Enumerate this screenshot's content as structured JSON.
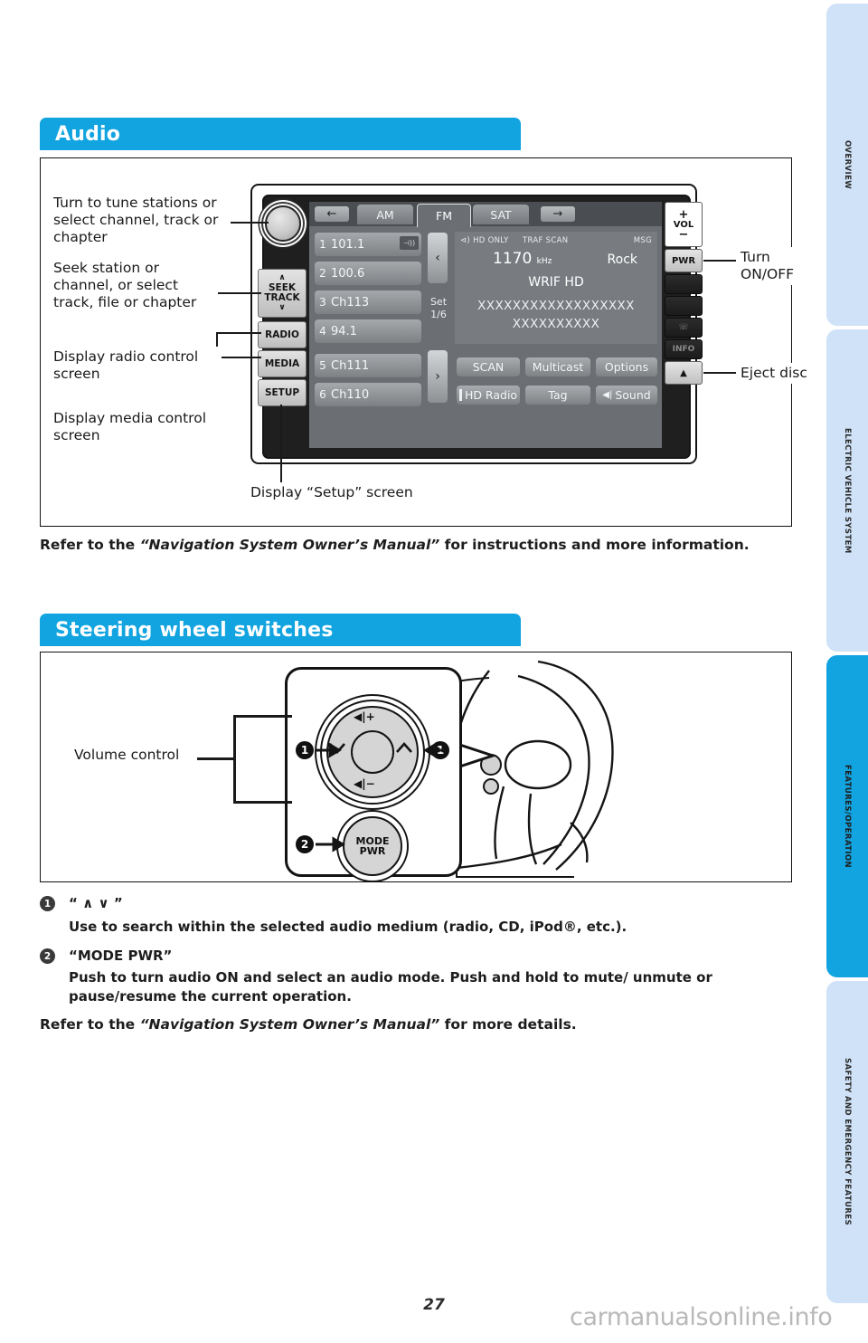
{
  "page": {
    "number": "27",
    "watermark": "carmanualsonline.info",
    "accent_color": "#12a4e0",
    "tab_inactive_color": "#cfe2f7"
  },
  "side_tabs": [
    {
      "label": "OVERVIEW",
      "active": false
    },
    {
      "label": "ELECTRIC VEHICLE SYSTEM",
      "active": false
    },
    {
      "label": "FEATURES/OPERATION",
      "active": true
    },
    {
      "label": "SAFETY AND EMERGENCY FEATURES",
      "active": false
    }
  ],
  "audio": {
    "heading": "Audio",
    "callouts": {
      "tune_knob": "Turn to tune stations or\nselect channel, track or\nchapter",
      "seek": "Seek station or\nchannel, or select\ntrack, file or chapter",
      "radio": "Display radio control\nscreen",
      "media": "Display media control\nscreen",
      "setup": "Display “Setup” screen",
      "power": "Turn\nON/OFF",
      "eject": "Eject disc"
    },
    "hard_buttons": {
      "seek_up": "∧",
      "seek_label_1": "SEEK",
      "seek_label_2": "TRACK",
      "seek_down": "∨",
      "radio": "RADIO",
      "media": "MEDIA",
      "setup": "SETUP"
    },
    "right_buttons": {
      "vol_plus": "+",
      "vol_label": "VOL",
      "vol_minus": "−",
      "power": "PWR",
      "eject": "▲",
      "blank_1": "",
      "blank_2": "",
      "blank_3": "☏",
      "blank_4": "INFO"
    },
    "screen": {
      "left_arrow": "←",
      "right_arrow": "→",
      "tabs": [
        {
          "label": "AM",
          "selected": false
        },
        {
          "label": "FM",
          "selected": true
        },
        {
          "label": "SAT",
          "selected": false
        }
      ],
      "presets": [
        {
          "no": "1",
          "value": "101.1",
          "hd": true
        },
        {
          "no": "2",
          "value": "100.6",
          "hd": false
        },
        {
          "no": "3",
          "value": "Ch113",
          "hd": false
        },
        {
          "no": "4",
          "value": "94.1",
          "hd": false
        },
        {
          "no": "5",
          "value": "Ch111",
          "hd": false
        },
        {
          "no": "6",
          "value": "Ch110",
          "hd": false
        }
      ],
      "prev_page": "‹",
      "next_page": "›",
      "set_label": "Set",
      "set_value": "1/6",
      "status_hd_only": "HD ONLY",
      "status_traf_scan": "TRAF SCAN",
      "status_msg": "MSG",
      "frequency": "1170",
      "frequency_unit": "kHz",
      "genre": "Rock",
      "station_name": "WRIF HD",
      "text_line_1": "XXXXXXXXXXXXXXXXXX",
      "text_line_2": "XXXXXXXXXX",
      "soft_buttons": [
        "SCAN",
        "Multicast",
        "Options",
        "HD Radio",
        "Tag",
        "Sound"
      ]
    },
    "refer_prefix": "Refer to the ",
    "refer_italic": "“Navigation System Owner’s Manual”",
    "refer_suffix": " for instructions and more information."
  },
  "steering": {
    "heading": "Steering wheel switches",
    "callouts": {
      "volume": "Volume control"
    },
    "controls": {
      "vol_up_icon": "◀|+",
      "vol_down_icon": "◀|−",
      "mode_line1": "MODE",
      "mode_line2": "PWR"
    },
    "markers": {
      "one": "1",
      "two": "2"
    },
    "items": [
      {
        "num": "1",
        "title": "“ ∧  ∨ ”",
        "body": "Use to search within the selected audio medium (radio, CD, iPod®, etc.)."
      },
      {
        "num": "2",
        "title": "“MODE PWR”",
        "body": "Push to turn audio ON and select an audio mode. Push and hold to mute/ unmute or pause/resume the current operation."
      }
    ],
    "refer_prefix": "Refer to the ",
    "refer_italic": "“Navigation System Owner’s Manual”",
    "refer_suffix": " for more details."
  }
}
